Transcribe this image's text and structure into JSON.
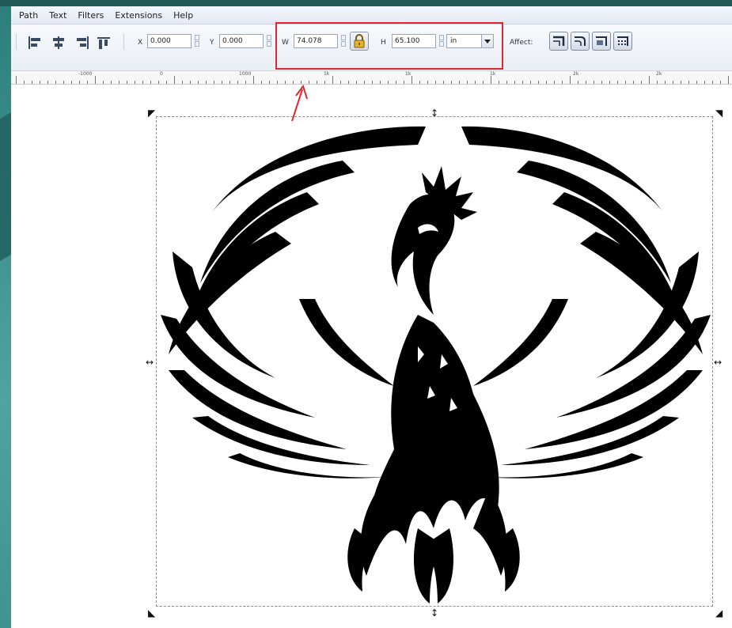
{
  "menu": [
    "Path",
    "Text",
    "Filters",
    "Extensions",
    "Help"
  ],
  "toolbar": {
    "x_label": "X",
    "x_value": "0.000",
    "y_label": "Y",
    "y_value": "0.000",
    "w_label": "W",
    "w_value": "74.078",
    "h_label": "H",
    "h_value": "65.100",
    "unit": "in",
    "affect_label": "Affect:"
  },
  "ruler": {
    "labels": [
      "-1000",
      "0",
      "1000",
      "1k",
      "1k",
      "1k",
      "2k",
      "2k"
    ]
  },
  "colors": {
    "highlight": "#e0272f",
    "background": "#3f8f8c"
  },
  "icons": [
    "align-left-icon",
    "align-center-icon",
    "align-right-icon",
    "align-top-icon",
    "lock-icon",
    "chevron-down-icon",
    "scale-stroke-icon",
    "scale-corners-icon",
    "move-gradients-icon",
    "move-patterns-icon",
    "phoenix-artwork",
    "annotation-arrow"
  ]
}
